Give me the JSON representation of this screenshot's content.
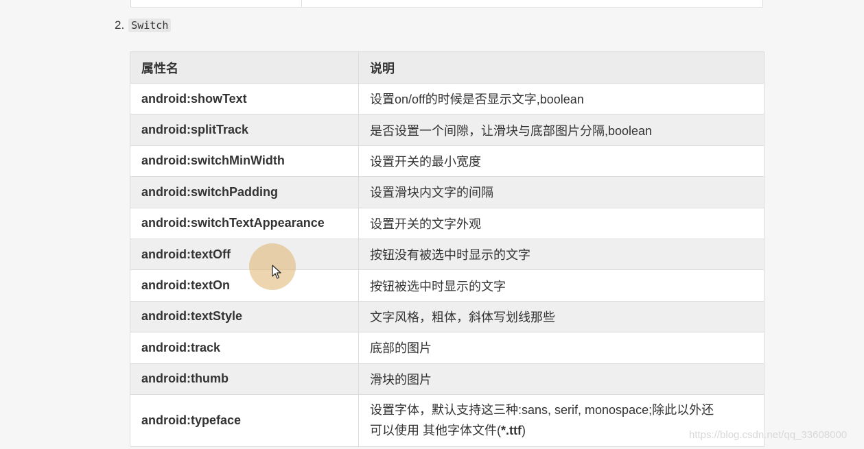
{
  "list_item": {
    "number": "2.",
    "code": "Switch"
  },
  "table": {
    "headers": [
      "属性名",
      "说明"
    ],
    "rows": [
      {
        "attr": "android:showText",
        "desc": "设置on/off的时候是否显示文字,boolean"
      },
      {
        "attr": "android:splitTrack",
        "desc": "是否设置一个间隙，让滑块与底部图片分隔,boolean"
      },
      {
        "attr": "android:switchMinWidth",
        "desc": "设置开关的最小宽度"
      },
      {
        "attr": "android:switchPadding",
        "desc": "设置滑块内文字的间隔"
      },
      {
        "attr": "android:switchTextAppearance",
        "desc": "设置开关的文字外观"
      },
      {
        "attr": "android:textOff",
        "desc": "按钮没有被选中时显示的文字"
      },
      {
        "attr": "android:textOn",
        "desc": "按钮被选中时显示的文字"
      },
      {
        "attr": "android:textStyle",
        "desc": "文字风格，粗体，斜体写划线那些"
      },
      {
        "attr": "android:track",
        "desc": "底部的图片"
      },
      {
        "attr": "android:thumb",
        "desc": "滑块的图片"
      },
      {
        "attr": "android:typeface",
        "desc_line1": "设置字体，默认支持这三种:sans, serif, monospace;除此以外还",
        "desc_line2_prefix": "可以使用 其他字体文件(",
        "desc_line2_bold": "*.ttf",
        "desc_line2_suffix": ")"
      }
    ]
  },
  "watermark": "https://blog.csdn.net/qq_33608000",
  "colors": {
    "background": "#f6f6f6",
    "header_bg": "#ececec",
    "row_alt": "#efefef",
    "border": "#dcdcdc",
    "cursor_halo": "#ddb26e"
  },
  "icons": {
    "cursor": "mouse-pointer-icon"
  }
}
